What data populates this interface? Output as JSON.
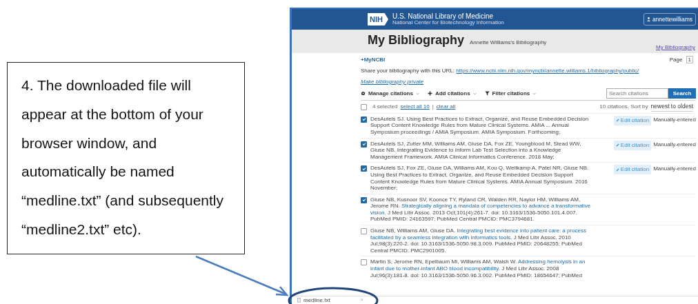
{
  "callout": {
    "text": "4.  The downloaded file will appear at the bottom of your browser window, and automatically be named “medline.txt” (and subsequently “medline2.txt” etc)."
  },
  "navbar": {
    "logo": "NIH",
    "org_name": "U.S. National Library of Medicine",
    "org_sub": "National Center for Biotechnology Information",
    "user": "annettewilliams"
  },
  "header": {
    "title": "My Bibliography",
    "subtitle": "Annette Williams's Bibliography",
    "help_link": "My Bibliography"
  },
  "share": {
    "back_link": "+MyNCBI",
    "label": "Share your bibliography with this URL:",
    "url": "https://www.ncbi.nlm.nih.gov/myncbi/annette.williams.1/bibliography/public/",
    "private_link": "Make bibliography private",
    "page_label": "Page",
    "page": "1"
  },
  "toolbar": {
    "menus": [
      {
        "label": "Manage citations"
      },
      {
        "label": "Add citations"
      },
      {
        "label": "Filter citations"
      }
    ],
    "search": {
      "placeholder": "Search citations",
      "button": "Search"
    }
  },
  "selection": {
    "all_checked": false,
    "count": "4 selected",
    "select_all": "select all 10",
    "separator": "|",
    "clear": "clear all",
    "total": "10 citations, Sort by",
    "sort": "newest to oldest"
  },
  "citations": [
    {
      "checked": true,
      "parts": [
        {
          "kind": "plain",
          "text": "DesAutels SJ. Using Best Practices to Extract, Organize, and Reuse Embedded Decision Support Content Knowledge Rules from Mature Clinical Systems. AMIA ... Annual Symposium proceedings / AMIA Symposium. AMIA Symposium. Forthcoming;"
        }
      ],
      "edit": "Edit citation",
      "source": "Manually-entered"
    },
    {
      "checked": true,
      "parts": [
        {
          "kind": "plain",
          "text": "DesAutels SJ, Zutter MM, Williams AM, Giuse DA, Fox ZE, Youngblood M, Stead WW, Giuse NB. Integrating Evidence to Inform Lab Test Selection into a Knowledge Management Framework. AMIA Clinical Informatics Conference. 2018 May;"
        }
      ],
      "edit": "Edit citation",
      "source": "Manually-entered"
    },
    {
      "checked": true,
      "parts": [
        {
          "kind": "plain",
          "text": "DesAutels SJ, Fox ZE, Giuse DA, Williams AM, Kou Q, Weitkamp A, Patel NR, Giuse NB. Using Best Practices to Extract, Organize, and Reuse Embedded Decision Support Content Knowledge Rules from Mature Clinical Systems. AMIA Annual Symposium. 2016 November;"
        }
      ],
      "edit": "Edit citation",
      "source": "Manually-entered"
    },
    {
      "checked": true,
      "parts": [
        {
          "kind": "plain",
          "text": "Giuse NB, Kusnoor SV, Koonce TY, Ryland CR, Walden RR, Naylor HM, Williams AM, Jerome RN. "
        },
        {
          "kind": "link",
          "text": "Strategically aligning a mandala of competencies to advance a transformative vision."
        },
        {
          "kind": "plain",
          "text": " J Med Libr Assoc. 2013 Oct;101(4):261-7. doi: 10.3163/1536-5050.101.4.007. PubMed PMID: 24163597; PubMed Central PMCID: PMC3794681."
        }
      ]
    },
    {
      "checked": false,
      "parts": [
        {
          "kind": "plain",
          "text": "Giuse NB, Williams AM, Giuse DA. "
        },
        {
          "kind": "link",
          "text": "Integrating best evidence into patient care: a process facilitated by a seamless integration with informatics tools."
        },
        {
          "kind": "plain",
          "text": " J Med Libr Assoc. 2010 Jul;98(3):220-2. doi: 10.3163/1536-5050.98.3.009. PubMed PMID: 20648255; PubMed Central PMCID: PMC2901005."
        }
      ]
    },
    {
      "checked": false,
      "parts": [
        {
          "kind": "plain",
          "text": "Martin S, Jerome RN, Epelbaum MI, Williams AM, Walsh W. "
        },
        {
          "kind": "link",
          "text": "Addressing hemolysis in an infant due to mother-infant ABO blood incompatibility."
        },
        {
          "kind": "plain",
          "text": " J Med Libr Assoc. 2008 Jul;96(3):181-8. doi: 10.3163/1536-5050.96.3.002. PubMed PMID: 18654647; PubMed"
        }
      ]
    }
  ],
  "download_bar": {
    "file": "medline.txt",
    "caret": "^"
  }
}
